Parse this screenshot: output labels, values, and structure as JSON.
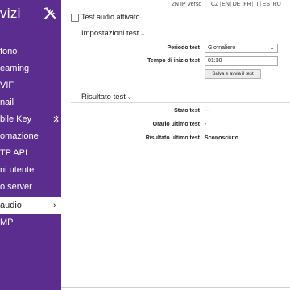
{
  "sidebar": {
    "title": "vizi",
    "tools_icon": "tools-icon",
    "items": [
      {
        "label": "fono"
      },
      {
        "label": "eaming"
      },
      {
        "label": "VIF"
      },
      {
        "label": "nail"
      },
      {
        "label": "bile Key",
        "icon": "bluetooth-icon"
      },
      {
        "label": "omazione"
      },
      {
        "label": "TP API"
      },
      {
        "label": "ni utente"
      },
      {
        "label": "o server"
      },
      {
        "label": "audio",
        "active": true,
        "icon": "chevron-right-icon"
      },
      {
        "label": "MP"
      }
    ]
  },
  "topbar": {
    "product": "2N IP Verso",
    "languages": [
      "CZ",
      "EN",
      "DE",
      "FR",
      "IT",
      "ES",
      "RU"
    ]
  },
  "main": {
    "enable_label": "Test audio attivato",
    "settings": {
      "title": "Impostazioni test",
      "period_label": "Periodo test",
      "period_value": "Giornaliero",
      "start_label": "Tempo di inizio test",
      "start_value": "01:30",
      "save_button": "Salva e avvia il test"
    },
    "result": {
      "title": "Risultato test",
      "status_label": "Stato test",
      "status_value": "---",
      "last_time_label": "Orario ultimo test",
      "last_time_value": "-",
      "last_result_label": "Risultato ultimo test",
      "last_result_value": "Sconosciuto"
    }
  },
  "colors": {
    "sidebar_bg": "#5b2d8e",
    "accent_blue": "#1a73e8"
  }
}
